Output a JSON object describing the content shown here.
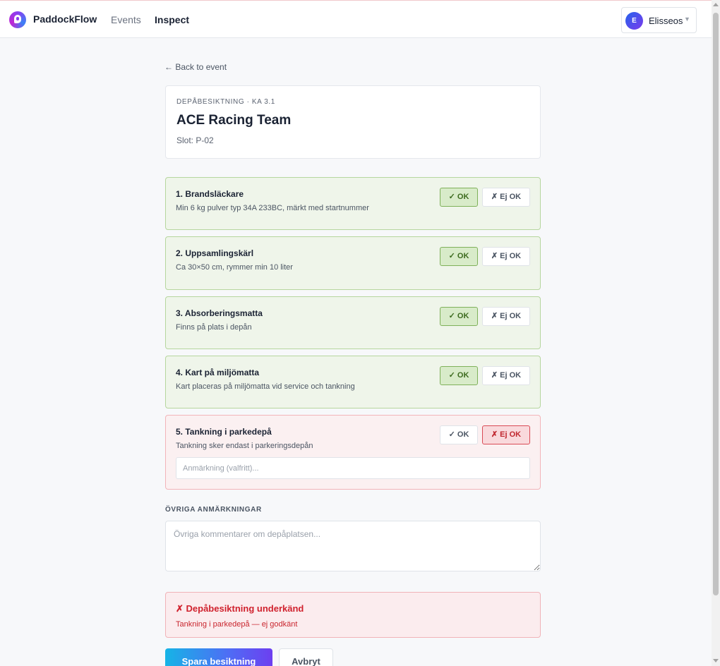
{
  "nav": {
    "brand": "PaddockFlow",
    "events": "Events",
    "inspect": "Inspect",
    "user_initial": "E",
    "user_name": "Elisseos",
    "caret": "▼"
  },
  "back_link": "← Back to event",
  "header": {
    "eyebrow": "DEPÅBESIKTNING · KA 3.1",
    "team": "ACE Racing Team",
    "slot": "Slot: P-02"
  },
  "checklist": [
    {
      "title": "1. Brandsläckare",
      "desc": "Min 6 kg pulver typ 34A 233BC, märkt med startnummer",
      "ok_label": "✓ OK",
      "fail_label": "✗ Ej OK",
      "status": "ok"
    },
    {
      "title": "2. Uppsamlingskärl",
      "desc": "Ca 30×50 cm, rymmer min 10 liter",
      "ok_label": "✓ OK",
      "fail_label": "✗ Ej OK",
      "status": "ok"
    },
    {
      "title": "3. Absorberingsmatta",
      "desc": "Finns på plats i depån",
      "ok_label": "✓ OK",
      "fail_label": "✗ Ej OK",
      "status": "ok"
    },
    {
      "title": "4. Kart på miljömatta",
      "desc": "Kart placeras på miljömatta vid service och tankning",
      "ok_label": "✓ OK",
      "fail_label": "✗ Ej OK",
      "status": "ok"
    },
    {
      "title": "5. Tankning i parkedepå",
      "desc": "Tankning sker endast i parkeringsdepån",
      "ok_label": "✓ OK",
      "fail_label": "✗ Ej OK",
      "status": "fail",
      "remark_placeholder": "Anmärkning (valfritt)...",
      "remark_value": ""
    }
  ],
  "other_remarks": {
    "label": "ÖVRIGA ANMÄRKNINGAR",
    "placeholder": "Övriga kommentarer om depåplatsen...",
    "value": ""
  },
  "result": {
    "title": "✗ Depåbesiktning underkänd",
    "reason": "Tankning i parkedepå — ej godkänt"
  },
  "actions": {
    "save": "Spara besiktning",
    "cancel": "Avbryt"
  },
  "colors": {
    "ok_accent": "#7fb15a",
    "fail_accent": "#d94a55",
    "primary_gradient_start": "#16b4e6",
    "primary_gradient_end": "#6d3ff0"
  },
  "icons": {
    "logo": "paddockflow-logo-icon",
    "user_caret": "chevron-down-icon",
    "back": "arrow-left-icon"
  }
}
